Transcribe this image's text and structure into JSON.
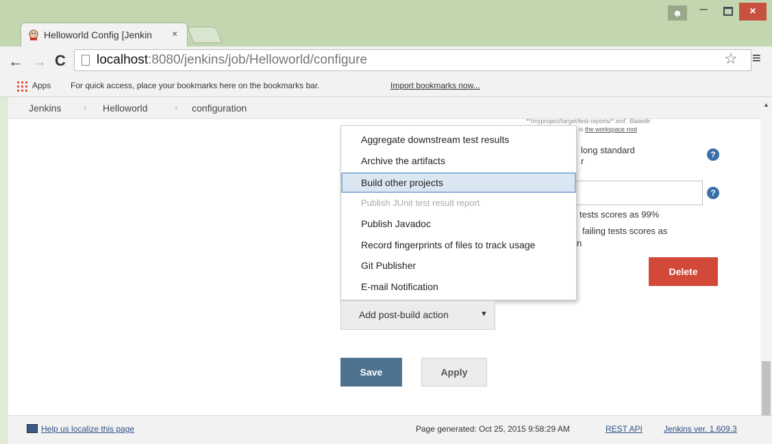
{
  "browser": {
    "tab_title": "Helloworld Config [Jenkin",
    "tab_close": "×",
    "url_host": "localhost",
    "url_path": ":8080/jenkins/job/Helloworld/configure",
    "back_icon": "back-arrow-icon",
    "forward_icon": "forward-arrow-icon",
    "reload_icon": "reload-icon",
    "star_icon": "bookmark-star-icon",
    "menu_icon": "hamburger-menu-icon"
  },
  "bookmarks_bar": {
    "apps_label": "Apps",
    "hint": "For quick access, place your bookmarks here on the bookmarks bar.",
    "import_link": "Import bookmarks now..."
  },
  "breadcrumb": [
    "Jenkins",
    "Helloworld",
    "configuration"
  ],
  "form_fragments": {
    "small_top": "**/myproject/target/test-reports/*.xml'. Basedir",
    "small_mid": "is",
    "small_link": "the workspace root",
    "long_standard": "long standard",
    "r_text": "r",
    "scores_99": "tests scores as 99%",
    "failing_scores": "failing tests scores as",
    "n_text": "n",
    "help_mark": "?"
  },
  "menu": {
    "items": [
      {
        "label": "Aggregate downstream test results",
        "state": "normal"
      },
      {
        "label": "Archive the artifacts",
        "state": "normal"
      },
      {
        "label": "Build other projects",
        "state": "highlighted"
      },
      {
        "label": "Publish JUnit test result report",
        "state": "disabled"
      },
      {
        "label": "Publish Javadoc",
        "state": "normal"
      },
      {
        "label": "Record fingerprints of files to track usage",
        "state": "normal"
      },
      {
        "label": "Git Publisher",
        "state": "normal"
      },
      {
        "label": "E-mail Notification",
        "state": "normal"
      }
    ]
  },
  "buttons": {
    "add_post_build": "Add post-build action",
    "caret": "▼",
    "delete": "Delete",
    "save": "Save",
    "apply": "Apply"
  },
  "footer": {
    "help_localize": "Help us localize this page",
    "page_generated": "Page generated: Oct 25, 2015 9:58:29 AM",
    "rest_api": "REST API",
    "version": "Jenkins ver. 1.609.3"
  },
  "colors": {
    "delete": "#d24939",
    "save": "#4e7390",
    "highlight": "#dbe6f3",
    "titlebar": "#c2d6b0"
  }
}
